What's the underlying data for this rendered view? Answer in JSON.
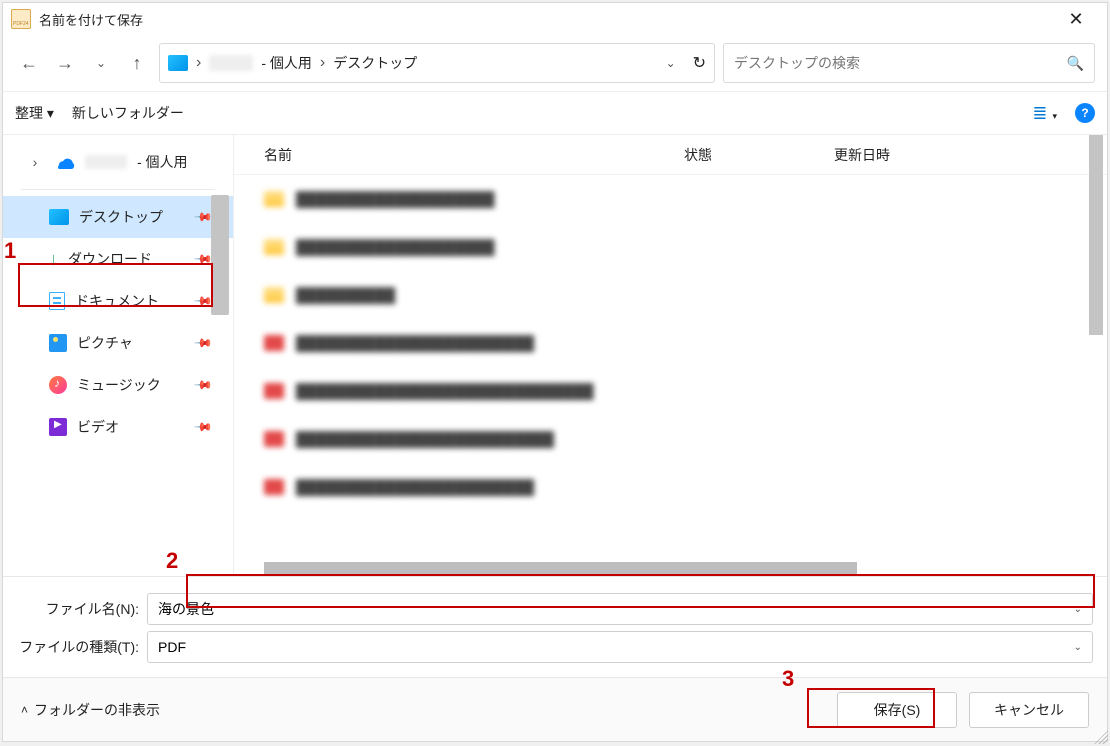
{
  "title": "名前を付けて保存",
  "breadcrumb": {
    "user_suffix": "- 個人用",
    "seg2": "デスクトップ"
  },
  "search": {
    "placeholder": "デスクトップの検索"
  },
  "toolbar": {
    "organize": "整理 ▾",
    "new_folder": "新しいフォルダー"
  },
  "columns": {
    "name": "名前",
    "state": "状態",
    "date": "更新日時"
  },
  "sidebar": {
    "top_suffix": "- 個人用",
    "desktop": "デスクトップ",
    "downloads": "ダウンロード",
    "documents": "ドキュメント",
    "pictures": "ピクチャ",
    "music": "ミュージック",
    "videos": "ビデオ"
  },
  "form": {
    "filename_label": "ファイル名(N):",
    "filetype_label": "ファイルの種類(T):",
    "filename_value": "海の景色",
    "filetype_value": "PDF"
  },
  "footer": {
    "hide_folders": "フォルダーの非表示",
    "save": "保存(S)",
    "cancel": "キャンセル"
  },
  "annotations": {
    "n1": "1",
    "n2": "2",
    "n3": "3"
  }
}
